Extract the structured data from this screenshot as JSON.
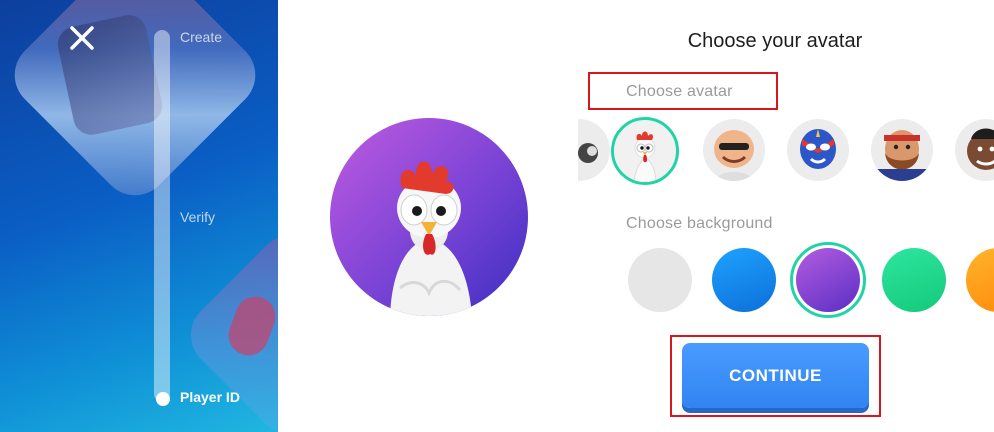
{
  "steps": {
    "create": "Create",
    "verify": "Verify",
    "player_id": "Player ID"
  },
  "main": {
    "title": "Choose your avatar",
    "avatar_section_label": "Choose avatar",
    "background_section_label": "Choose background",
    "continue_label": "CONTINUE"
  },
  "avatars": [
    {
      "name": "partial-avatar",
      "selected": false
    },
    {
      "name": "chicken",
      "selected": true
    },
    {
      "name": "bald-guy-sunglasses",
      "selected": false
    },
    {
      "name": "luchador",
      "selected": false
    },
    {
      "name": "barbarian",
      "selected": false
    },
    {
      "name": "hog-rider",
      "selected": false
    }
  ],
  "backgrounds": [
    {
      "name": "gray",
      "color": "#e6e6e6",
      "selected": false
    },
    {
      "name": "blue",
      "color": "#1487ea",
      "selected": false
    },
    {
      "name": "purple",
      "color": "#7b3fd0",
      "selected": true
    },
    {
      "name": "green",
      "color": "#20d98c",
      "selected": false
    },
    {
      "name": "orange",
      "color": "#ffa318",
      "selected": false
    }
  ],
  "colors": {
    "accent_ring": "#22d3a6",
    "button": "#3184f1",
    "highlight_box": "#d6171b"
  }
}
